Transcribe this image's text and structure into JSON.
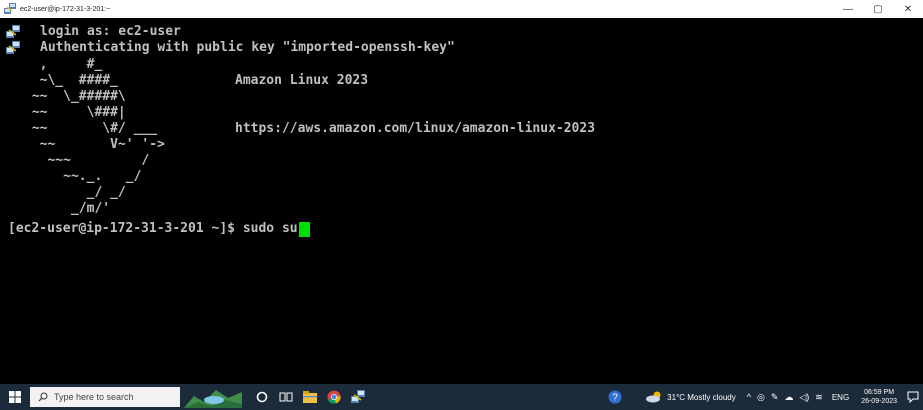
{
  "window": {
    "title": "ec2-user@ip-172-31-3-201:~",
    "controls": {
      "minimize": "—",
      "maximize": "▢",
      "close": "✕"
    }
  },
  "terminal": {
    "login_line": "login as: ec2-user",
    "auth_line": "Authenticating with public key \"imported-openssh-key\"",
    "ascii_art": [
      "  ,     #_",
      "  ~\\_  ####_",
      " ~~  \\_#####\\",
      " ~~     \\###|",
      " ~~       \\#/ ___",
      "  ~~       V~' '->",
      "   ~~~         /",
      "     ~~._.   _/",
      "        _/ _/",
      "      _/m/'"
    ],
    "banner_title": "Amazon Linux 2023",
    "banner_url": "https://aws.amazon.com/linux/amazon-linux-2023",
    "prompt": "[ec2-user@ip-172-31-3-201 ~]$ ",
    "command": "sudo su",
    "cursor_color": "#00e000"
  },
  "taskbar": {
    "search_placeholder": "Type here to search",
    "weather": "31°C  Mostly cloudy",
    "language": "ENG",
    "time": "06:59 PM",
    "date": "26-09-2023"
  }
}
